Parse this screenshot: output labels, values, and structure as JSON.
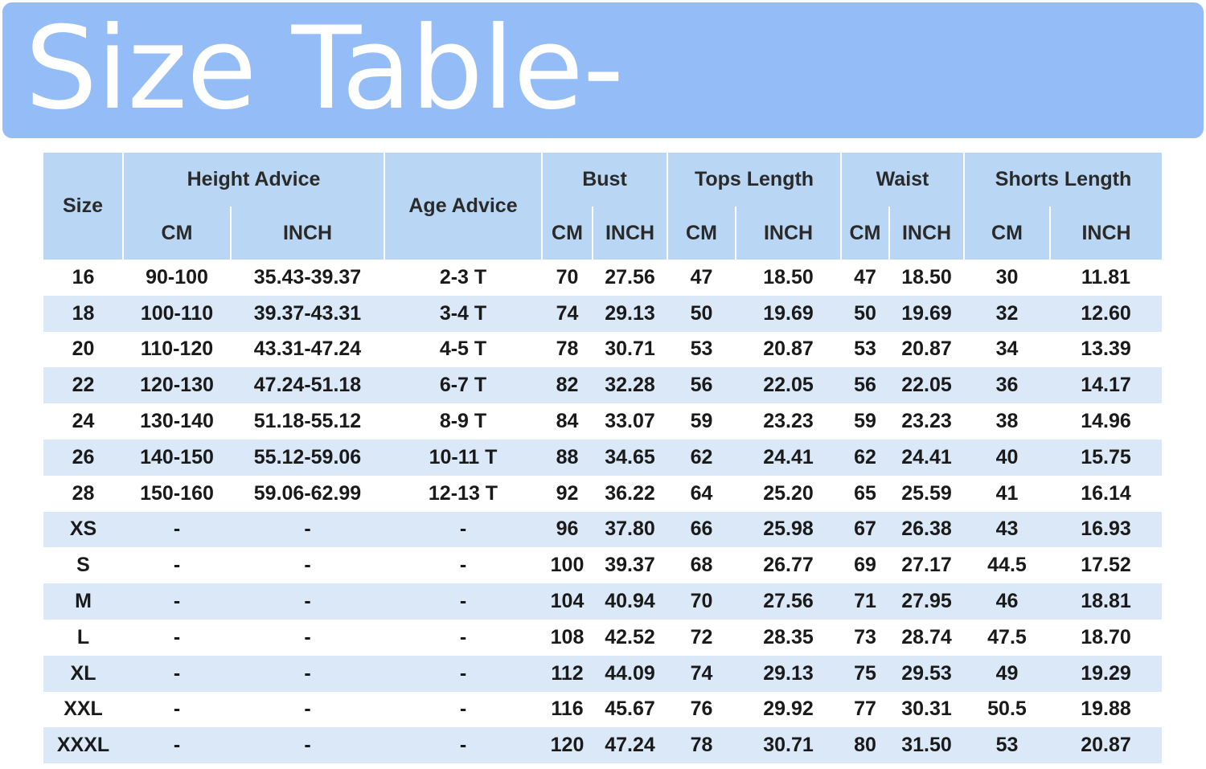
{
  "banner": {
    "title": "Size Table-",
    "color": "#94bdf8"
  },
  "table": {
    "header_color": "#b9d7f4",
    "stripe_color": "#dbe8f7",
    "headers": {
      "size": "Size",
      "height_advice": "Height Advice",
      "age_advice": "Age Advice",
      "bust": "Bust",
      "tops_length": "Tops Length",
      "waist": "Waist",
      "shorts_length": "Shorts Length",
      "cm": "CM",
      "inch": "INCH"
    },
    "rows": [
      [
        "16",
        "90-100",
        "35.43-39.37",
        "2-3 T",
        "70",
        "27.56",
        "47",
        "18.50",
        "47",
        "18.50",
        "30",
        "11.81"
      ],
      [
        "18",
        "100-110",
        "39.37-43.31",
        "3-4 T",
        "74",
        "29.13",
        "50",
        "19.69",
        "50",
        "19.69",
        "32",
        "12.60"
      ],
      [
        "20",
        "110-120",
        "43.31-47.24",
        "4-5 T",
        "78",
        "30.71",
        "53",
        "20.87",
        "53",
        "20.87",
        "34",
        "13.39"
      ],
      [
        "22",
        "120-130",
        "47.24-51.18",
        "6-7 T",
        "82",
        "32.28",
        "56",
        "22.05",
        "56",
        "22.05",
        "36",
        "14.17"
      ],
      [
        "24",
        "130-140",
        "51.18-55.12",
        "8-9 T",
        "84",
        "33.07",
        "59",
        "23.23",
        "59",
        "23.23",
        "38",
        "14.96"
      ],
      [
        "26",
        "140-150",
        "55.12-59.06",
        "10-11 T",
        "88",
        "34.65",
        "62",
        "24.41",
        "62",
        "24.41",
        "40",
        "15.75"
      ],
      [
        "28",
        "150-160",
        "59.06-62.99",
        "12-13 T",
        "92",
        "36.22",
        "64",
        "25.20",
        "65",
        "25.59",
        "41",
        "16.14"
      ],
      [
        "XS",
        "-",
        "-",
        "-",
        "96",
        "37.80",
        "66",
        "25.98",
        "67",
        "26.38",
        "43",
        "16.93"
      ],
      [
        "S",
        "-",
        "-",
        "-",
        "100",
        "39.37",
        "68",
        "26.77",
        "69",
        "27.17",
        "44.5",
        "17.52"
      ],
      [
        "M",
        "-",
        "-",
        "-",
        "104",
        "40.94",
        "70",
        "27.56",
        "71",
        "27.95",
        "46",
        "18.81"
      ],
      [
        "L",
        "-",
        "-",
        "-",
        "108",
        "42.52",
        "72",
        "28.35",
        "73",
        "28.74",
        "47.5",
        "18.70"
      ],
      [
        "XL",
        "-",
        "-",
        "-",
        "112",
        "44.09",
        "74",
        "29.13",
        "75",
        "29.53",
        "49",
        "19.29"
      ],
      [
        "XXL",
        "-",
        "-",
        "-",
        "116",
        "45.67",
        "76",
        "29.92",
        "77",
        "30.31",
        "50.5",
        "19.88"
      ],
      [
        "XXXL",
        "-",
        "-",
        "-",
        "120",
        "47.24",
        "78",
        "30.71",
        "80",
        "31.50",
        "53",
        "20.87"
      ]
    ]
  }
}
